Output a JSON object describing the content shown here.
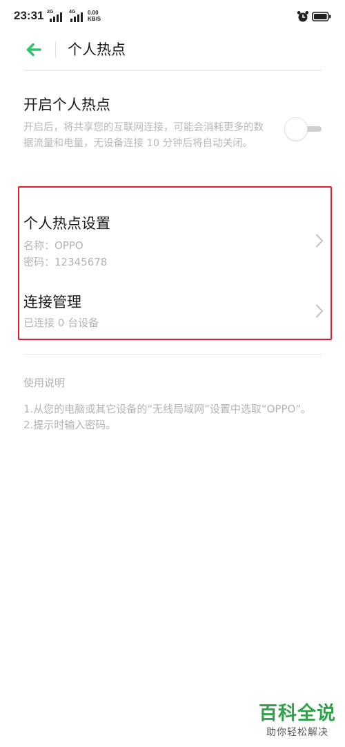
{
  "status_bar": {
    "time": "23:31",
    "sim1_tag": "2G",
    "sim2_tag": "4G",
    "net_speed_value": "0.00",
    "net_speed_unit": "KB/S",
    "icons": [
      "signal-icon",
      "alarm-icon",
      "battery-icon"
    ]
  },
  "header": {
    "title": "个人热点",
    "back_icon": "arrow-left-icon"
  },
  "hotspot": {
    "title": "开启个人热点",
    "description": "开启后，将共享您的互联网连接，可能会消耗更多的数据流量和电量，无设备连接 10 分钟后将自动关闭。",
    "enabled": false
  },
  "settings": {
    "hotspot_settings": {
      "title": "个人热点设置",
      "name": "名称：OPPO",
      "password": "密码：12345678"
    },
    "connection_management": {
      "title": "连接管理",
      "status": "已连接 0 台设备"
    }
  },
  "help": {
    "title": "使用说明",
    "step1": "1.从您的电脑或其它设备的“无线局域网”设置中选取“OPPO”。",
    "step2": "2.提示时输入密码。"
  },
  "watermark": {
    "main": "百科全说",
    "sub": "助你轻松解决"
  },
  "colors": {
    "accent_green": "#2fc46b",
    "highlight_red": "#e8192c",
    "watermark_green": "#2fa24a"
  }
}
